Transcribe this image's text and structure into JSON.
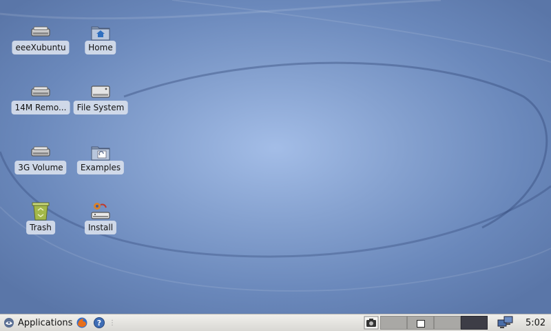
{
  "desktop": {
    "icons": [
      {
        "label": "eeeXubuntu",
        "icon": "drive-icon"
      },
      {
        "label": "Home",
        "icon": "home-folder-icon"
      },
      {
        "label": "14M Remo...",
        "icon": "drive-icon"
      },
      {
        "label": "File System",
        "icon": "filesystem-drive-icon"
      },
      {
        "label": "3G Volume",
        "icon": "drive-icon"
      },
      {
        "label": "Examples",
        "icon": "examples-folder-icon"
      },
      {
        "label": "Trash",
        "icon": "trash-icon"
      },
      {
        "label": "Install",
        "icon": "install-icon"
      }
    ]
  },
  "panel": {
    "applications_label": "Applications",
    "clock": "5:02",
    "workspaces": 4,
    "active_workspace": 4
  },
  "colors": {
    "desktop_bg": "#86a2d0",
    "panel_bg": "#e5e4e0",
    "label_bg": "#d7deec"
  }
}
